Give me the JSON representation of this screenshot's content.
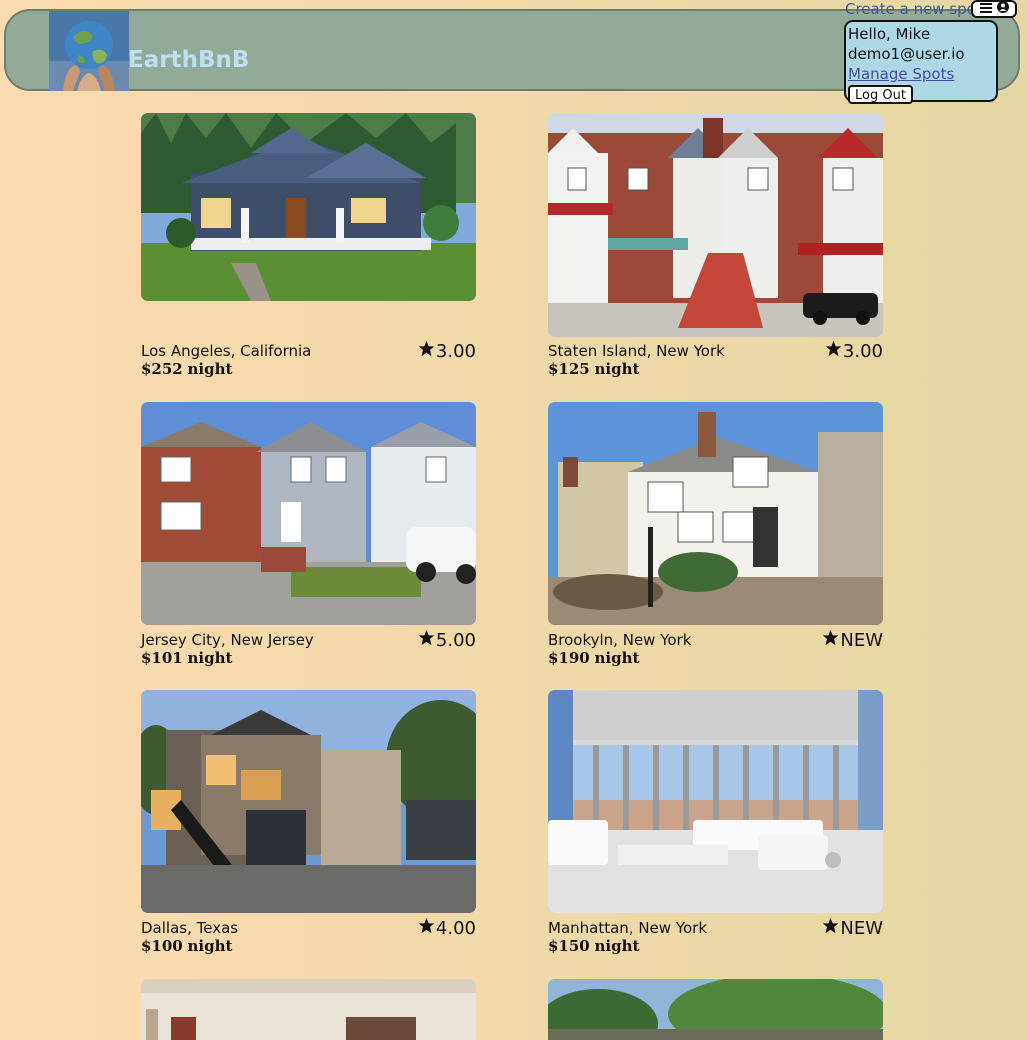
{
  "header": {
    "brand": "EarthBnB",
    "create_link": "Create a new spot",
    "menu_icon": "hamburger-icon",
    "user_icon": "user-circle-icon"
  },
  "user_menu": {
    "greeting": "Hello, Mike",
    "email": "demo1@user.io",
    "manage_link": "Manage Spots",
    "logout_label": "Log Out"
  },
  "spots": [
    {
      "location": "Los Angeles, California",
      "rating": "3.00",
      "price": "$252",
      "per": "night"
    },
    {
      "location": "Staten Island, New York",
      "rating": "3.00",
      "price": "$125",
      "per": "night"
    },
    {
      "location": "Jersey City, New Jersey",
      "rating": "5.00",
      "price": "$101",
      "per": "night"
    },
    {
      "location": "Brookyln, New York",
      "rating": "NEW",
      "price": "$190",
      "per": "night"
    },
    {
      "location": "Dallas, Texas",
      "rating": "4.00",
      "price": "$100",
      "per": "night"
    },
    {
      "location": "Manhattan, New York",
      "rating": "NEW",
      "price": "$150",
      "per": "night"
    }
  ],
  "colors": {
    "header_bg": "#93aa98",
    "brand_text": "#bedff0",
    "menu_bg": "#add8e6",
    "page_bg_left": "#fadbb0",
    "page_bg_right": "#e4d7a3"
  }
}
